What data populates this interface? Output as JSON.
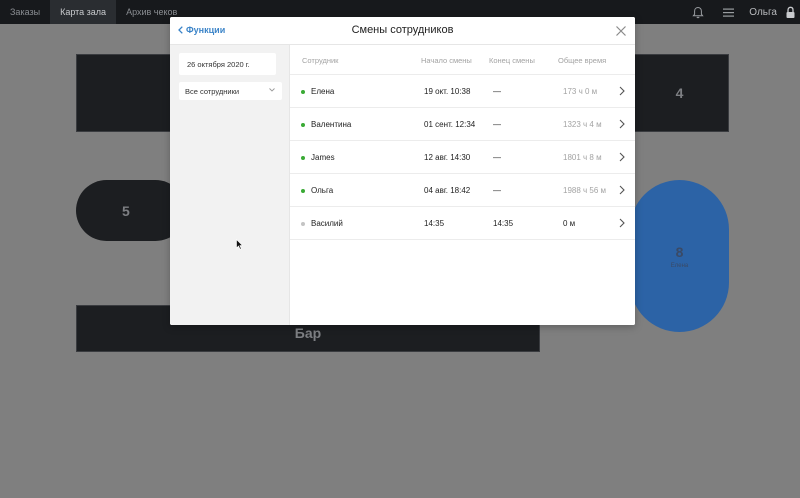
{
  "topbar": {
    "tabs": [
      {
        "label": "Заказы",
        "active": false
      },
      {
        "label": "Карта зала",
        "active": true
      },
      {
        "label": "Архив чеков",
        "active": false
      }
    ],
    "user_name": "Ольга",
    "icons": [
      "bell-icon",
      "menu-icon",
      "lock-icon"
    ]
  },
  "hall": {
    "tables": [
      {
        "label": "4"
      },
      {
        "label": "5"
      },
      {
        "label": "8",
        "sub": "Елена"
      },
      {
        "label": "Бар"
      }
    ]
  },
  "modal": {
    "back_label": "Функции",
    "title": "Смены сотрудников",
    "filters": {
      "date": "26 октября 2020 г.",
      "employee": "Все сотрудники"
    },
    "columns": [
      "Сотрудник",
      "Начало смены",
      "Конец смены",
      "Общее время"
    ],
    "rows": [
      {
        "name": "Елена",
        "start": "19 окт. 10:38",
        "end": "—",
        "total": "173 ч 0 м",
        "active": true
      },
      {
        "name": "Валентина",
        "start": "01 сент. 12:34",
        "end": "—",
        "total": "1323 ч 4 м",
        "active": true
      },
      {
        "name": "James",
        "start": "12 авг. 14:30",
        "end": "—",
        "total": "1801 ч 8 м",
        "active": true
      },
      {
        "name": "Ольга",
        "start": "04 авг. 18:42",
        "end": "—",
        "total": "1988 ч 56 м",
        "active": true
      },
      {
        "name": "Василий",
        "start": "14:35",
        "end": "14:35",
        "total": "0 м",
        "active": false
      }
    ]
  },
  "colors": {
    "accent": "#3b84c8",
    "active_dot": "#3aaa35",
    "inactive_dot": "#c4c4c4",
    "busy_table": "#2c63a6"
  }
}
